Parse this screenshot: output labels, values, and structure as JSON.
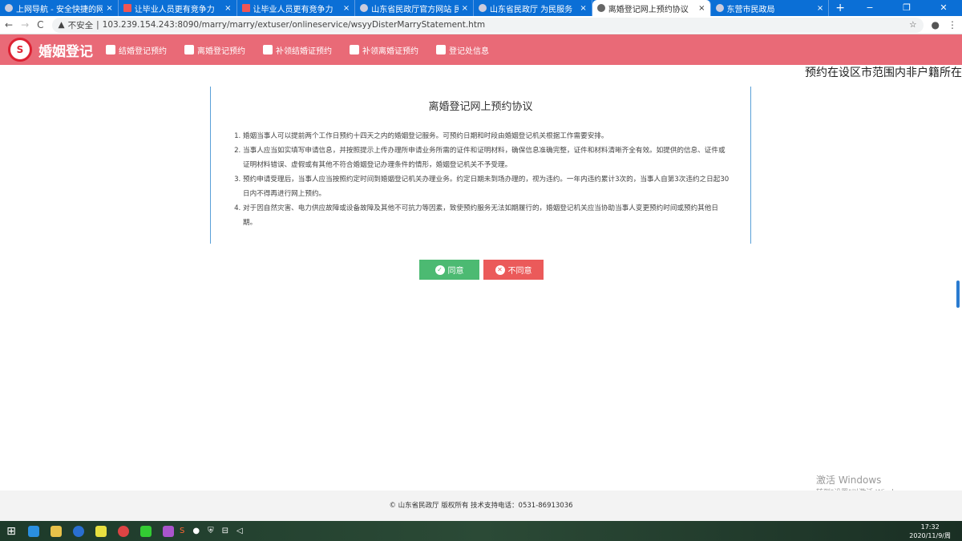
{
  "browser": {
    "tabs": [
      {
        "label": "上网导航 - 安全快捷的网址大全",
        "active": false
      },
      {
        "label": "让毕业人员更有竞争力",
        "active": false
      },
      {
        "label": "让毕业人员更有竞争力",
        "active": false
      },
      {
        "label": "山东省民政厅官方网站 民政服务",
        "active": false
      },
      {
        "label": "山东省民政厅 为民服务",
        "active": false
      },
      {
        "label": "离婚登记网上预约协议",
        "active": true
      },
      {
        "label": "东营市民政局",
        "active": false
      }
    ],
    "new_tab": "+",
    "security": "不安全",
    "url": "103.239.154.243:8090/marry/marry/extuser/onlineservice/wsyyDisterMarryStatement.htm"
  },
  "nav": {
    "brand": "婚姻登记",
    "items": [
      {
        "label": "结婚登记预约"
      },
      {
        "label": "离婚登记预约"
      },
      {
        "label": "补领结婚证预约"
      },
      {
        "label": "补领离婚证预约"
      },
      {
        "label": "登记处信息"
      }
    ]
  },
  "marquee": "预约在设区市范围内非户籍所在",
  "agreement": {
    "title": "离婚登记网上预约协议",
    "items": [
      "婚姻当事人可以提前两个工作日预约十四天之内的婚姻登记服务。可预约日期和时段由婚姻登记机关根据工作需要安排。",
      "当事人应当如实填写申请信息，并按照提示上传办理所申请业务所需的证件和证明材料，确保信息准确完整，证件和材料清晰齐全有效。如提供的信息、证件或证明材料错误、虚假或有其他不符合婚姻登记办理条件的情形，婚姻登记机关不予受理。",
      "预约申请受理后，当事人应当按照约定时间到婚姻登记机关办理业务。约定日期未到场办理的，视为违约。一年内违约累计3次的，当事人自第3次违约之日起30日内不得再进行网上预约。",
      "对于因自然灾害、电力供应故障或设备故障及其他不可抗力等因素，致使预约服务无法如期履行的，婚姻登记机关应当协助当事人变更预约时间或预约其他日期。"
    ],
    "agree": "同意",
    "disagree": "不同意"
  },
  "footer": "© 山东省民政厅 版权所有   技术支持电话：0531-86913036",
  "activation": {
    "line1": "激活 Windows",
    "line2": "转到\"设置\"以激活 Windows。"
  },
  "taskbar": {
    "time": "17:32",
    "date": "2020/11/9/周"
  }
}
